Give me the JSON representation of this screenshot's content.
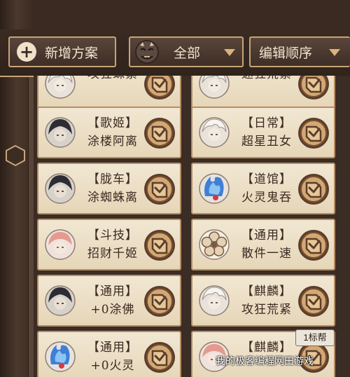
{
  "toolbar": {
    "add_label": "新增方案",
    "filter_label": "全部",
    "edit_order_label": "编辑顺序"
  },
  "cards": [
    {
      "line1": "",
      "line2": "攻狂蛛紧",
      "avatar": "white-hair-shikigami"
    },
    {
      "line1": "",
      "line2": "速狂荒紧",
      "avatar": "white-hair-shikigami"
    },
    {
      "line1": "【歌姬】",
      "line2": "涂楼阿离",
      "avatar": "dark-hair-shikigami"
    },
    {
      "line1": "【日常】",
      "line2": "超星丑女",
      "avatar": "white-hair-shikigami"
    },
    {
      "line1": "【胧车】",
      "line2": "涂蜘蛛离",
      "avatar": "dark-hair-shikigami"
    },
    {
      "line1": "【道馆】",
      "line2": "火灵鬼吞",
      "avatar": "blue-flame-shikigami"
    },
    {
      "line1": "【斗技】",
      "line2": "招财千姬",
      "avatar": "pink-hair-shikigami"
    },
    {
      "line1": "【通用】",
      "line2": "散件一速",
      "avatar": "flower-emblem"
    },
    {
      "line1": "【通用】",
      "line2": "+0涂佛",
      "avatar": "dark-hair-shikigami"
    },
    {
      "line1": "【麒麟】",
      "line2": "攻狂荒紧",
      "avatar": "white-hair-shikigami"
    },
    {
      "line1": "【通用】",
      "line2": "+0火灵",
      "avatar": "blue-flame-shikigami"
    },
    {
      "line1": "【麒麟】",
      "line2": "",
      "avatar": "pink-hair-shikigami"
    }
  ],
  "tooltip": "1标帮",
  "watermark": "我的极客编程网田游戏",
  "colors": {
    "accent_gold": "#c9a477",
    "card_bg": "#efe4cf",
    "panel_dark": "#3a2a22"
  }
}
